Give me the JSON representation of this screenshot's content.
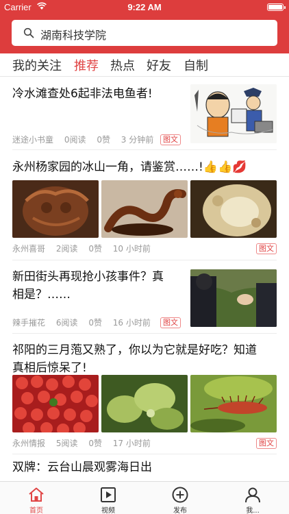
{
  "status_bar": {
    "carrier": "Carrier",
    "time": "9:22 AM"
  },
  "search": {
    "text": "湖南科技学院"
  },
  "tabs": [
    {
      "label": "我的关注"
    },
    {
      "label": "推荐"
    },
    {
      "label": "热点"
    },
    {
      "label": "好友"
    },
    {
      "label": "自制"
    }
  ],
  "active_tab": "推荐",
  "articles": [
    {
      "title": "冷水滩查处6起非法电鱼者!",
      "author": "迷途小书童",
      "reads": "0阅读",
      "likes": "0赞",
      "time": "3 分钟前",
      "tag": "图文"
    },
    {
      "title": "永州杨家园的冰山一角，请鉴赏……!",
      "emoji": "👍👍💋",
      "author": "永州喜哥",
      "reads": "2阅读",
      "likes": "0赞",
      "time": "10 小时前",
      "tag": "图文"
    },
    {
      "title_line1": "新田街头再现抢小孩事件？真",
      "title_line2": "相是？……",
      "author": "辣手摧花",
      "reads": "6阅读",
      "likes": "0赞",
      "time": "16 小时前",
      "tag": "图文"
    },
    {
      "title_line1": "祁阳的三月萢又熟了，你以为它就是好吃？知道",
      "title_line2": "真相后惊呆了!",
      "author": "永州情报",
      "reads": "5阅读",
      "likes": "0赞",
      "time": "17 小时前",
      "tag": "图文"
    },
    {
      "title": "双牌：云台山晨观雾海日出"
    }
  ],
  "bottom_nav": [
    {
      "label": "首页"
    },
    {
      "label": "视频"
    },
    {
      "label": "发布"
    },
    {
      "label": "我..."
    }
  ],
  "colors": {
    "brand": "#dd3d3d",
    "accent_text": "#e04545",
    "meta_text": "#999999"
  }
}
